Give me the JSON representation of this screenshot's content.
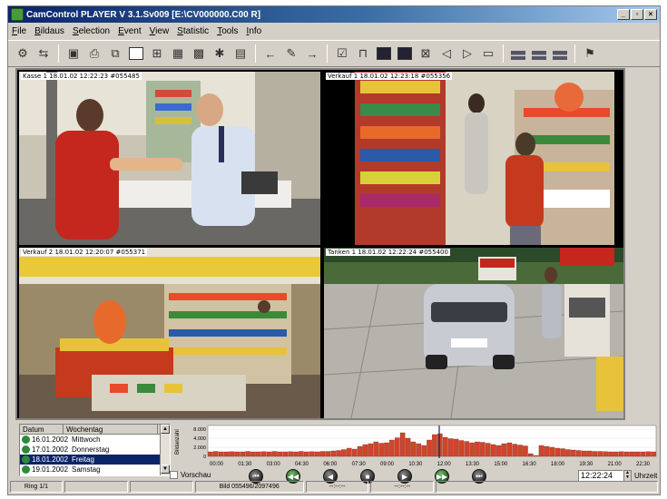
{
  "window": {
    "title": "CamControl PLAYER V 3.1.Sv009 [E:\\CV000000.C00 R]",
    "minimize": "_",
    "restore": "▫",
    "close": "×"
  },
  "menu": [
    "File",
    "Bildaus",
    "Selection",
    "Event",
    "View",
    "Statistic",
    "Tools",
    "Info"
  ],
  "cameras": [
    {
      "label": "Kasse 1  18.01.02  12:22:23  #055485"
    },
    {
      "label": "Verkauf 1  18.01.02  12:23:18  #055356"
    },
    {
      "label": "Verkauf 2  18.01.02  12:20:07  #055371"
    },
    {
      "label": "Tanken 1  18.01.02  12:22:24  #055400"
    }
  ],
  "datelist": {
    "headers": [
      "Datum",
      "Wochentag"
    ],
    "rows": [
      {
        "date": "16.01.2002",
        "day": "Mittwoch"
      },
      {
        "date": "17.01.2002",
        "day": "Donnerstag"
      },
      {
        "date": "18.01.2002",
        "day": "Freitag"
      },
      {
        "date": "19.01.2002",
        "day": "Samstag"
      }
    ],
    "selected_index": 2
  },
  "vorschau_label": "Vorschau",
  "histogram": {
    "y_label": "Bildanzahl",
    "y_ticks": [
      "8.000",
      "4.000",
      "2.000",
      "0"
    ],
    "x_ticks": [
      "00:00",
      "01:30",
      "03:00",
      "04:30",
      "06:00",
      "07:30",
      "09:00",
      "10:30",
      "12:00",
      "13:30",
      "15:00",
      "16:30",
      "18:00",
      "19:30",
      "21:00",
      "22:30"
    ],
    "bar_color": "#d0452a",
    "values": [
      1000,
      1100,
      1000,
      1000,
      1050,
      1000,
      1000,
      1100,
      1000,
      1000,
      1050,
      1000,
      1100,
      1000,
      1000,
      1050,
      1000,
      1100,
      1000,
      1050,
      1000,
      1100,
      1100,
      1200,
      1300,
      1500,
      1800,
      1600,
      2200,
      2600,
      2800,
      3200,
      2900,
      3000,
      3600,
      4100,
      5200,
      4000,
      3200,
      2800,
      2400,
      3600,
      4800,
      5000,
      4200,
      3900,
      3800,
      3500,
      3300,
      3000,
      3200,
      3100,
      2900,
      2600,
      2400,
      2800,
      3000,
      2700,
      2500,
      2300,
      600,
      200,
      2400,
      2200,
      2000,
      1800,
      1700,
      1500,
      1400,
      1300,
      1200,
      1200,
      1100,
      1100,
      1050,
      1000,
      1000,
      1050,
      1000,
      1000,
      1000,
      1000,
      1050,
      1000
    ]
  },
  "playback": [
    "⏮",
    "◀◀",
    "◀",
    "■",
    "▶",
    "▶▶",
    "⏭"
  ],
  "time_value": "12:22:24",
  "time_unit": "Uhrzeit",
  "status": [
    "Ring 1/1",
    "",
    "",
    "Bild 055496/2097496",
    "--:--:--",
    "--:--:--",
    ""
  ]
}
